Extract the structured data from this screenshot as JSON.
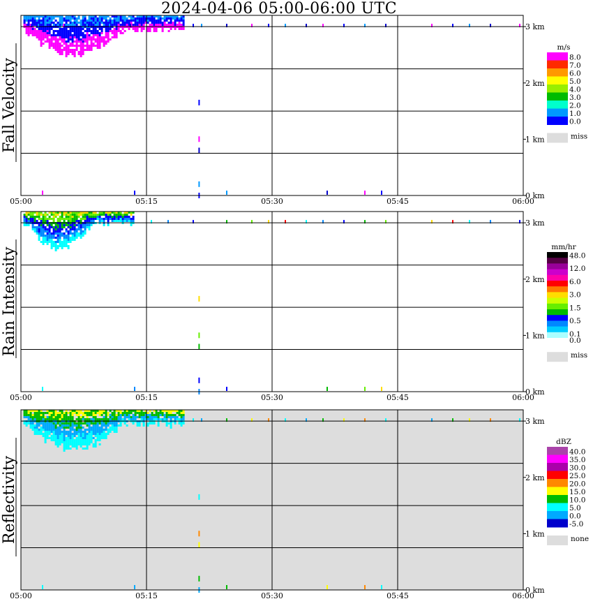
{
  "title": "2024-04-06  05:00-06:00 UTC",
  "chart_data": [
    {
      "type": "heatmap",
      "ylabel": "Fall Velocity",
      "x_ticks": [
        "05:00",
        "05:15",
        "05:30",
        "05:45",
        "06:00"
      ],
      "y_ticks": [
        "0 km",
        "1 km",
        "2 km",
        "3 km"
      ],
      "colorbar": {
        "unit": "m/s",
        "labels": [
          "8.0",
          "7.0",
          "6.0",
          "5.0",
          "4.0",
          "3.0",
          "2.0",
          "1.0",
          "0.0"
        ],
        "colors": [
          "#ff00ff",
          "#ff2a00",
          "#ff9900",
          "#ffff00",
          "#99ee00",
          "#00bb00",
          "#00ffcc",
          "#0099ff",
          "#0000ff"
        ],
        "missing_label": "miss",
        "missing_color": "#dddddd"
      },
      "background": "#ffffff",
      "features": {
        "main": {
          "x0": 0.3,
          "x1": 19.5,
          "ytop": 3.2,
          "ybottom": 2.45,
          "colors": [
            "#ff00ff",
            "#0000ff",
            "#0099ff",
            "#0000cc"
          ]
        },
        "scatter_x": [
          0.5,
          1.2,
          2.0,
          3.5,
          5.0,
          8.0,
          10.5,
          13.0,
          16.0,
          20.5,
          21.5,
          24.5,
          27.5,
          29.5,
          31.5,
          34.0,
          36.0,
          38.5,
          41.0,
          43.5,
          49.0,
          51.5,
          53.5,
          56.0,
          59.5
        ],
        "column_x": 21.2
      }
    },
    {
      "type": "heatmap",
      "ylabel": "Rain Intensity",
      "x_ticks": [
        "05:00",
        "05:15",
        "05:30",
        "05:45",
        "06:00"
      ],
      "y_ticks": [
        "0 km",
        "1 km",
        "2 km",
        "3 km"
      ],
      "colorbar": {
        "unit": "mm/hr",
        "labels": [
          "48.0",
          "",
          "12.0",
          "",
          "6.0",
          "",
          "3.0",
          "",
          "1.5",
          "",
          "0.5",
          "",
          "0.1",
          "0.0"
        ],
        "colors": [
          "#000000",
          "#550044",
          "#990099",
          "#cc00cc",
          "#ff00aa",
          "#ff0000",
          "#ff7700",
          "#ffdd00",
          "#ccff00",
          "#66ee00",
          "#00bb00",
          "#0000ff",
          "#0088ff",
          "#00ccff",
          "#aaffff",
          "#ffffff"
        ],
        "missing_label": "miss",
        "missing_color": "#dddddd"
      },
      "background": "#ffffff",
      "features": {
        "main": {
          "x0": 0.3,
          "x1": 13.5,
          "ytop": 3.2,
          "ybottom": 2.5,
          "colors": [
            "#00ffff",
            "#0088ff",
            "#0000ff",
            "#00bb00",
            "#66ee00",
            "#ffdd00",
            "#ff0000"
          ]
        },
        "scatter_x": [
          15.5,
          17.5,
          20.5,
          24.5,
          27.5,
          29.5,
          31.5,
          34.0,
          36.0,
          38.5,
          41.0,
          43.5,
          49.0,
          51.5,
          53.5,
          56.0,
          59.5
        ],
        "column_x": 21.2
      }
    },
    {
      "type": "heatmap",
      "ylabel": "Reflectivity",
      "x_ticks": [
        "05:00",
        "05:15",
        "05:30",
        "05:45",
        "06:00"
      ],
      "y_ticks": [
        "0 km",
        "1 km",
        "2 km",
        "3 km"
      ],
      "colorbar": {
        "unit": "dBZ",
        "labels": [
          "40.0",
          "35.0",
          "30.0",
          "25.0",
          "20.0",
          "15.0",
          "10.0",
          "5.0",
          "0.0",
          "-5.0"
        ],
        "colors": [
          "#aa44aa",
          "#ff00ff",
          "#aa00aa",
          "#ff0000",
          "#ff8800",
          "#ffff00",
          "#00bb00",
          "#00ffff",
          "#00aaff",
          "#0000cc"
        ],
        "missing_label": "none",
        "missing_color": "#dddddd"
      },
      "background": "#dddddd",
      "features": {
        "main": {
          "x0": 0.3,
          "x1": 19.5,
          "ytop": 3.2,
          "ybottom": 2.45,
          "colors": [
            "#00ffff",
            "#00aaff",
            "#00bb00",
            "#ffff00",
            "#ff8800"
          ]
        },
        "scatter_x": [
          20.5,
          21.5,
          24.5,
          27.5,
          29.5,
          31.5,
          34.0,
          36.0,
          38.5,
          41.0,
          43.5,
          49.0,
          51.5,
          53.5,
          56.0,
          59.5
        ],
        "column_x": 21.2
      }
    }
  ]
}
